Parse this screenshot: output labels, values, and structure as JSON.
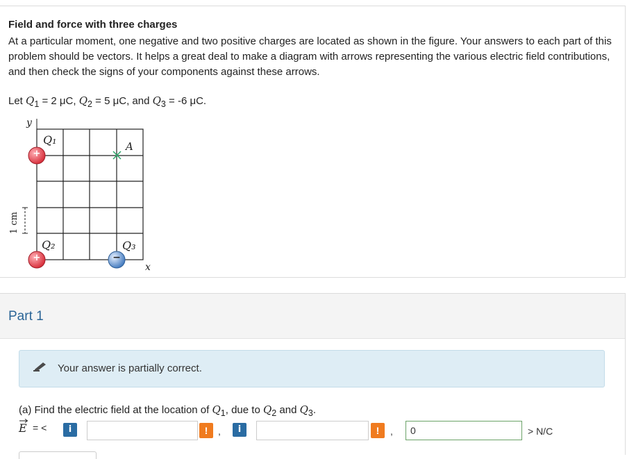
{
  "problem": {
    "title": "Field and force with three charges",
    "description": "At a particular moment, one negative and two positive charges are located as shown in the figure. Your answers to each part of this problem should be vectors. It helps a great deal to make a diagram with arrows representing the various electric field contributions, and then check the signs of your components against these arrows.",
    "let_prefix": "Let ",
    "q1_symbol": "Q",
    "q1_sub": "1",
    "q1_value": " = 2 μC, ",
    "q2_symbol": "Q",
    "q2_sub": "2",
    "q2_value": " = 5 μC, and ",
    "q3_symbol": "Q",
    "q3_sub": "3",
    "q3_value": " = -6 μC."
  },
  "figure": {
    "y_axis_label": "y",
    "x_axis_label": "x",
    "scale_label": "1 cm",
    "charge_q1_label": "Q₁",
    "charge_q2_label": "Q₂",
    "charge_q3_label": "Q₃",
    "point_a_label": "A",
    "plus_sign": "+",
    "minus_sign": "−",
    "colors": {
      "positive_charge": "#d9333f",
      "negative_charge": "#4a7fc1",
      "marker_a": "#2aa86a",
      "grid": "#222222"
    }
  },
  "part": {
    "title": "Part 1",
    "feedback_text": "Your answer is partially correct.",
    "question_prefix": "(a) Find the electric field at the location of ",
    "question_q1": "Q",
    "question_q1_sub": "1",
    "question_mid": ", due to ",
    "question_q2": "Q",
    "question_q2_sub": "2",
    "question_and": " and ",
    "question_q3": "Q",
    "question_q3_sub": "3",
    "question_end": "."
  },
  "answer": {
    "vector_symbol": "E",
    "equals_open": "= <",
    "info_glyph": "i",
    "warn_glyph": "!",
    "comma": ",",
    "x_component_value": "",
    "y_component_value": "",
    "z_component_value": "0",
    "unit_suffix": "> N/C"
  }
}
